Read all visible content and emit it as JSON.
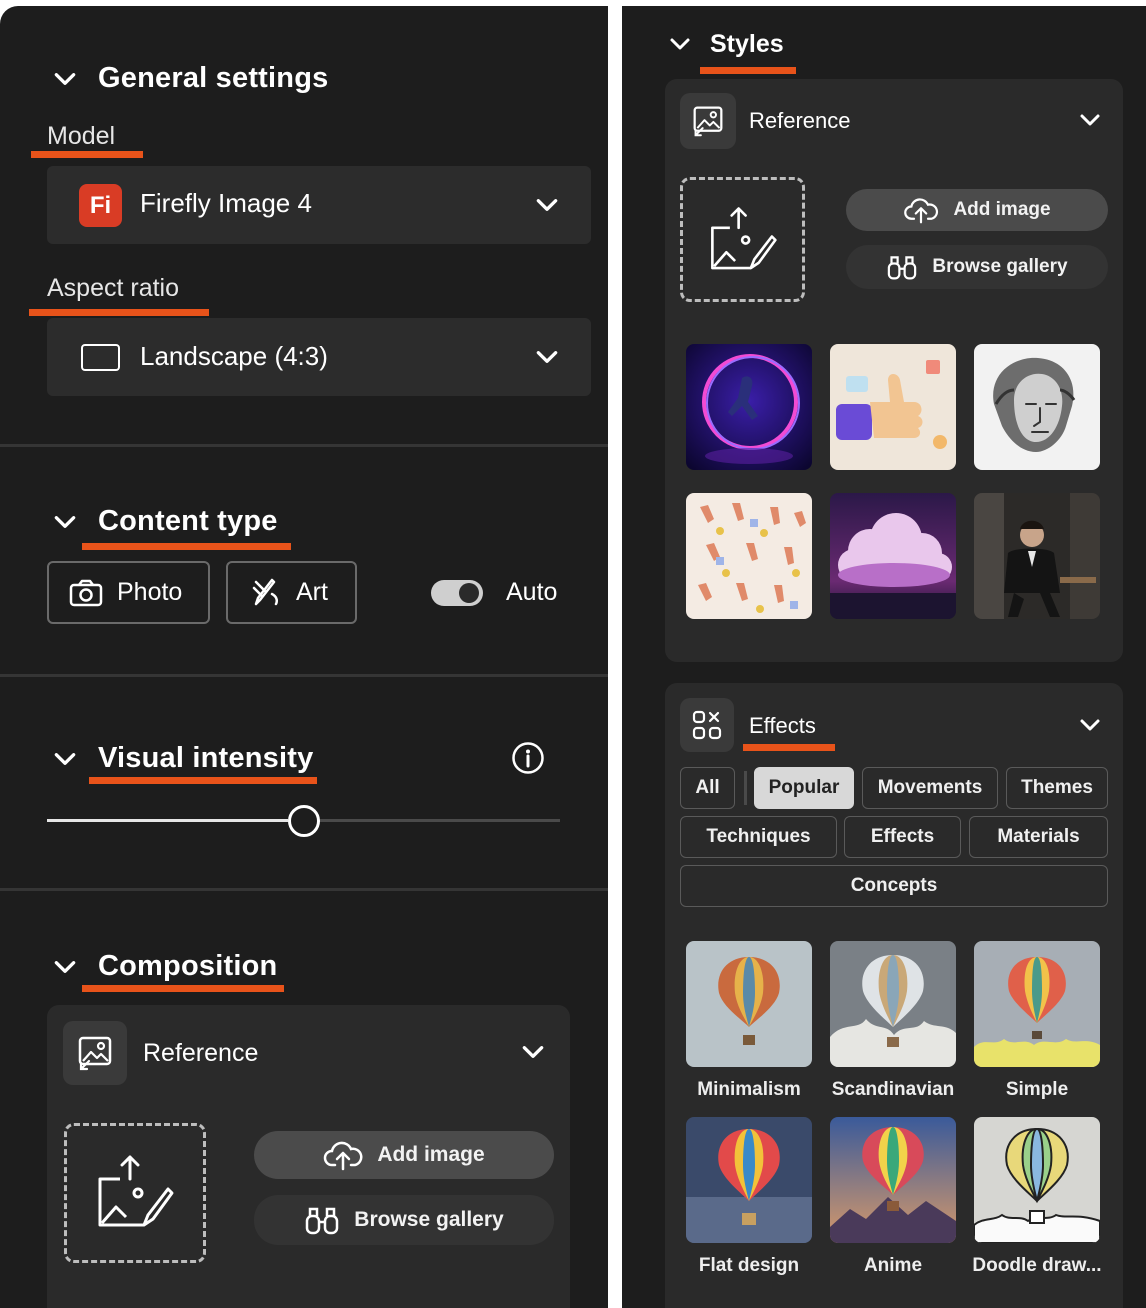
{
  "general": {
    "title": "General settings",
    "model_label": "Model",
    "model_value": "Firefly Image 4",
    "model_badge": "Fi",
    "aspect_label": "Aspect ratio",
    "aspect_value": "Landscape (4:3)"
  },
  "content_type": {
    "title": "Content type",
    "photo": "Photo",
    "art": "Art",
    "auto": "Auto",
    "auto_on": true
  },
  "visual_intensity": {
    "title": "Visual intensity",
    "value": 0.5
  },
  "composition": {
    "title": "Composition",
    "reference": "Reference",
    "add_image": "Add image",
    "browse_gallery": "Browse gallery"
  },
  "styles": {
    "title": "Styles",
    "reference": "Reference",
    "add_image": "Add image",
    "browse_gallery": "Browse gallery"
  },
  "effects": {
    "title": "Effects",
    "filters": [
      "All",
      "Popular",
      "Movements",
      "Themes",
      "Techniques",
      "Effects",
      "Materials",
      "Concepts"
    ],
    "selected_filter": "Popular",
    "styles": [
      "Minimalism",
      "Scandinavian",
      "Simple",
      "Flat design",
      "Anime",
      "Doodle draw..."
    ]
  },
  "colors": {
    "accent_underline": "#e8531a",
    "panel_bg": "#1d1d1d",
    "firefly_badge": "#d93c25"
  }
}
